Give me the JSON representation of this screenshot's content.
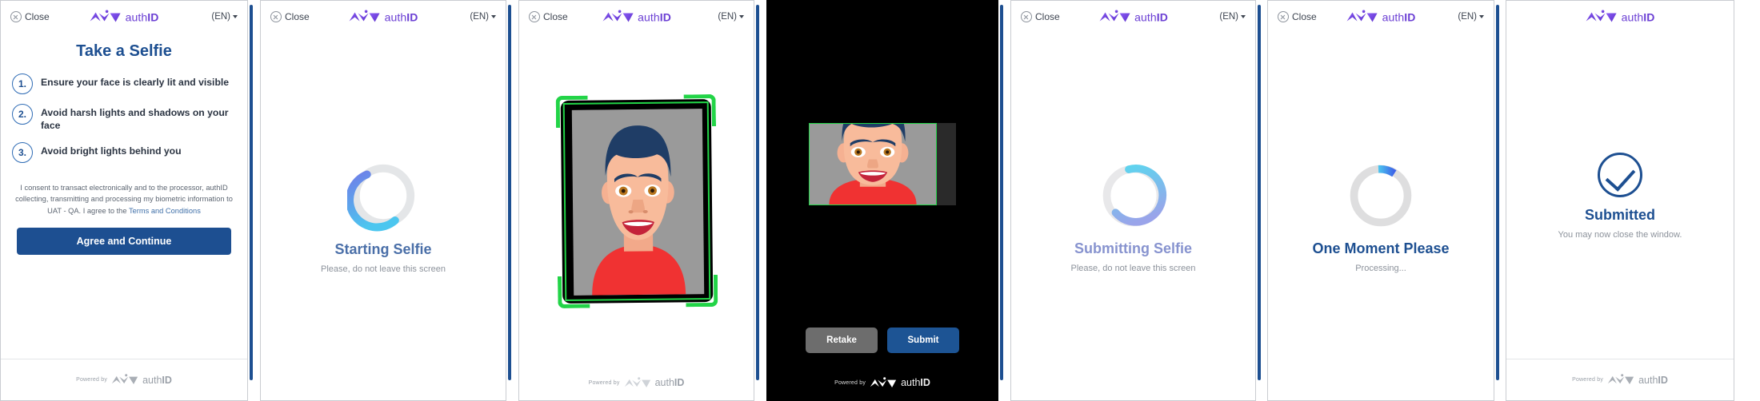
{
  "brand": {
    "name_light": "auth",
    "name_bold": "ID",
    "logo_color": "#6b3fd4",
    "powered_by": "Powered by"
  },
  "header": {
    "close_label": "Close",
    "close_icon": "circle-x-icon",
    "language": "(EN)",
    "caret_icon": "chevron-down-icon"
  },
  "panels": [
    {
      "id": "instructions",
      "title": "Take a Selfie",
      "steps": [
        {
          "num": "1.",
          "text": "Ensure your face is clearly lit and visible"
        },
        {
          "num": "2.",
          "text": "Avoid harsh lights and shadows on your face"
        },
        {
          "num": "3.",
          "text": "Avoid bright lights behind you"
        }
      ],
      "consent_text": "I consent to transact electronically and to the processor, authID collecting, transmitting and processing my biometric information to UAT - QA. I agree to the",
      "consent_link": "Terms and Conditions",
      "cta_label": "Agree and Continue",
      "cta_color": "#1d4f91"
    },
    {
      "id": "starting-selfie",
      "title": "Starting Selfie",
      "subtitle": "Please, do not leave this screen",
      "title_color": "#4a6fa8",
      "spinner": {
        "track": "#e4e6e8",
        "from": "#6f7fe8",
        "to": "#4cc6ef",
        "sweep": 260
      }
    },
    {
      "id": "camera-capture",
      "frame_color": "#22d447",
      "feed_background": "#9a9a9a"
    },
    {
      "id": "review-photo",
      "background": "#000000",
      "retake_label": "Retake",
      "retake_color": "#6d6d6d",
      "submit_label": "Submit",
      "submit_color": "#1d5494",
      "frame_color": "#22d447"
    },
    {
      "id": "submitting-selfie",
      "title": "Submitting Selfie",
      "subtitle": "Please, do not leave this screen",
      "title_color": "#8793cf",
      "spinner": {
        "track": "#e8e8ea",
        "from": "#5fd3ee",
        "to": "#9aa4ea",
        "sweep": 300
      }
    },
    {
      "id": "processing",
      "title": "One Moment Please",
      "subtitle": "Processing...",
      "title_color": "#1d4f91",
      "spinner": {
        "track": "#dededf",
        "from": "#4cc6ef",
        "to": "#3d63e8",
        "sweep": 34
      }
    },
    {
      "id": "submitted",
      "title": "Submitted",
      "subtitle": "You may now close the window.",
      "title_color": "#1d4f91",
      "check_icon": "check-circle-icon",
      "check_color": "#1d4f91"
    }
  ]
}
